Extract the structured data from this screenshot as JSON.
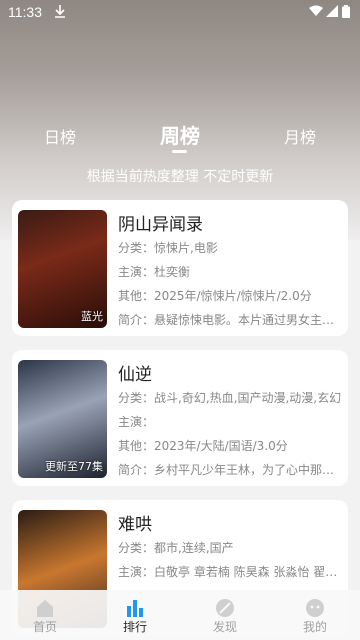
{
  "status_bar": {
    "time": "11:33"
  },
  "tabs": [
    {
      "label": "日榜"
    },
    {
      "label": "周榜"
    },
    {
      "label": "月榜"
    }
  ],
  "subtitle": "根据当前热度整理 不定时更新",
  "cards": [
    {
      "title": "阴山异闻录",
      "badge": "蓝光",
      "category": "分类：惊悚片,电影",
      "cast": "主演：杜奕衡",
      "other": "其他：2025年/惊悚片/惊悚片/2.0分",
      "summary": "简介：悬疑惊悚电影。本片通过男女主人公的..."
    },
    {
      "title": "仙逆",
      "badge": "更新至77集",
      "category": "分类：战斗,奇幻,热血,国产动漫,动漫,玄幻",
      "cast": "主演：",
      "other": "其他：2023年/大陆/国语/3.0分",
      "summary": "简介：乡村平凡少年王林，为了心中那不屈..."
    },
    {
      "title": "难哄",
      "badge": "",
      "category": "分类：都市,连续,国产",
      "cast": "主演：白敬亭 章若楠 陈昊森 张淼怡 翟潇...",
      "other": "",
      "summary": ""
    }
  ],
  "bottom_nav": [
    {
      "label": "首页",
      "icon": "home-icon"
    },
    {
      "label": "排行",
      "icon": "rank-icon"
    },
    {
      "label": "发现",
      "icon": "discover-icon"
    },
    {
      "label": "我的",
      "icon": "profile-icon"
    }
  ],
  "colors": {
    "active_nav": "#2196f3",
    "inactive": "#c8c8c8"
  }
}
